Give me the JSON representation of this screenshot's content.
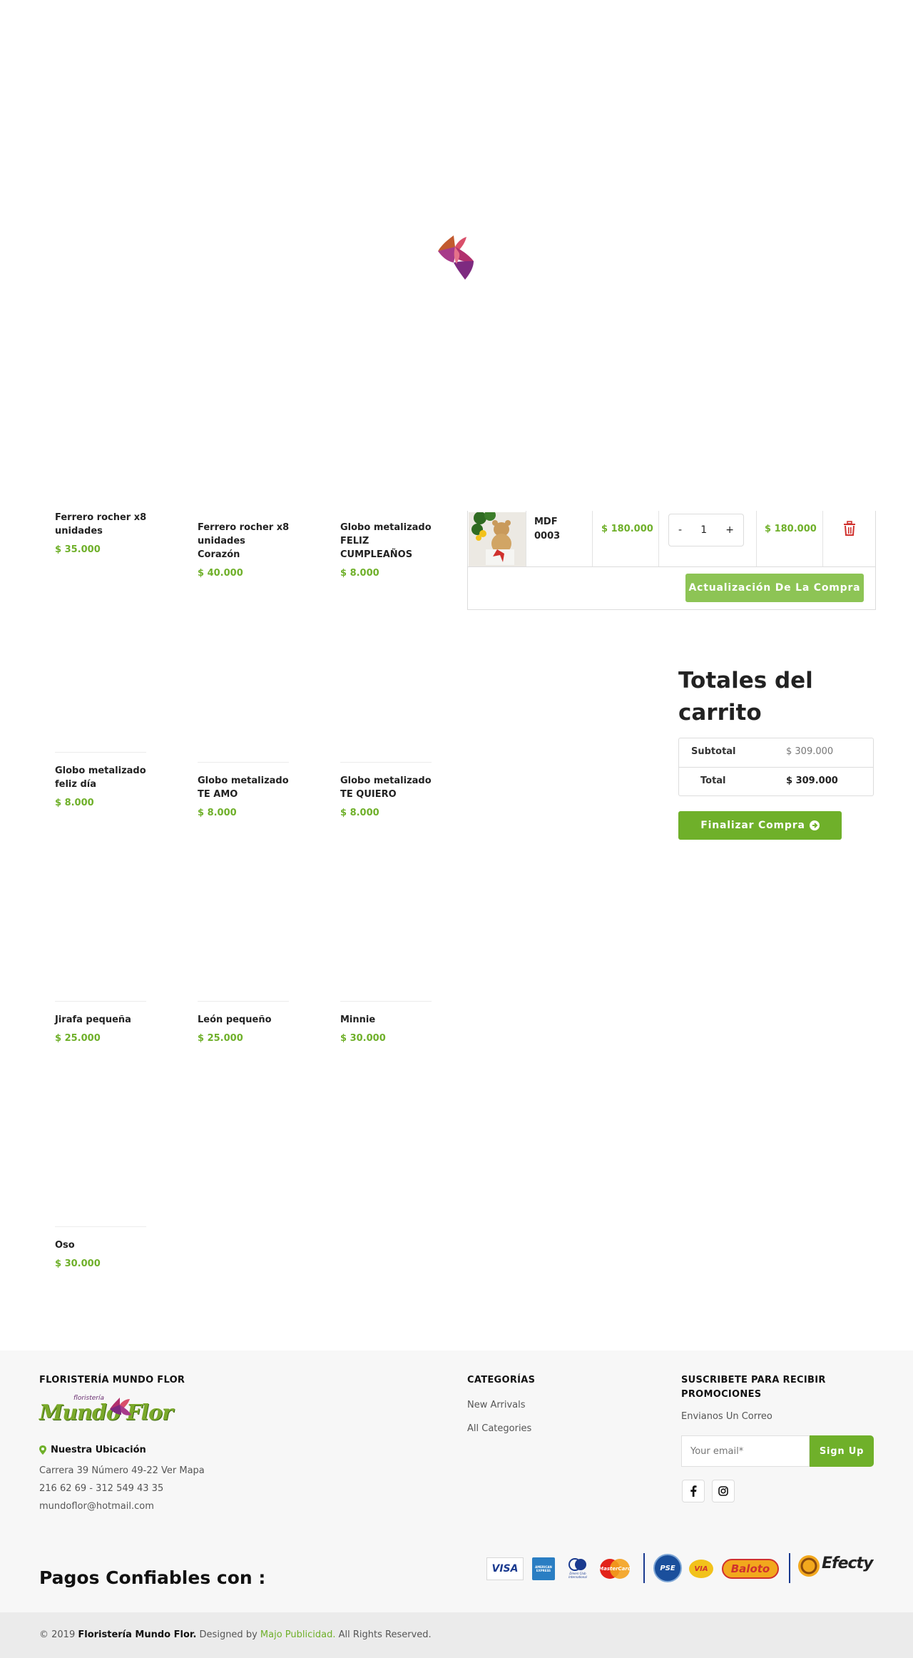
{
  "products": [
    {
      "name": "Ferrero rocher x8 unidades",
      "price": "$ 35.000"
    },
    {
      "name": "Ferrero rocher x8 unidades Corazón",
      "price": "$ 40.000"
    },
    {
      "name": "Globo metalizado FELIZ CUMPLEAÑOS",
      "price": "$ 8.000"
    },
    {
      "name": "Globo metalizado feliz día",
      "price": "$ 8.000"
    },
    {
      "name": "Globo metalizado TE AMO",
      "price": "$ 8.000"
    },
    {
      "name": "Globo metalizado TE QUIERO",
      "price": "$ 8.000"
    },
    {
      "name": "Jirafa pequeña",
      "price": "$ 25.000"
    },
    {
      "name": "León pequeño",
      "price": "$ 25.000"
    },
    {
      "name": "Minnie",
      "price": "$ 30.000"
    },
    {
      "name": "Oso",
      "price": "$ 30.000"
    }
  ],
  "cart": {
    "item": {
      "name": "MDF 0003",
      "price": "$ 180.000",
      "qty_minus": "-",
      "qty": "1",
      "qty_plus": "+",
      "total": "$ 180.000"
    },
    "update_button": "Actualización De La Compra"
  },
  "totals": {
    "title": "Totales del carrito",
    "subtotal_label": "Subtotal",
    "subtotal_value": "$ 309.000",
    "total_label": "Total",
    "total_value": "$ 309.000",
    "checkout_button": "Finalizar Compra"
  },
  "footer": {
    "brand_heading": "FLORISTERÍA MUNDO FLOR",
    "logo_small": "floristería",
    "logo_text": "Mundo Flor",
    "location_heading": "Nuestra Ubicación",
    "address": "Carrera 39 Número 49-22 Ver Mapa",
    "phones": "216 62 69 - 312 549 43 35",
    "email": "mundoflor@hotmail.com",
    "categories_heading": "CATEGORÍAS",
    "categories": [
      "New Arrivals",
      "All Categories"
    ],
    "subscribe_heading": "SUSCRIBETE PARA RECIBIR PROMOCIONES",
    "subscribe_sub": "Envianos Un Correo",
    "email_placeholder": "Your email*",
    "signup_button": "Sign Up",
    "payments_title": "Pagos Confiables con :",
    "payment_methods": [
      "VISA",
      "AMERICAN EXPRESS",
      "Diners Club International",
      "MasterCard",
      "PSE",
      "VIA",
      "Baloto",
      "Efecty"
    ],
    "copyright_prefix": "© 2019",
    "copyright_brand": "Floristería Mundo Flor.",
    "copyright_designed": "Designed by",
    "copyright_designer": "Majo Publicidad.",
    "copyright_suffix": "All Rights Reserved."
  },
  "colors": {
    "accent": "#6fb02a",
    "accent_light": "#8dc455",
    "danger": "#d0312d",
    "footer_bg": "#f7f7f7"
  }
}
